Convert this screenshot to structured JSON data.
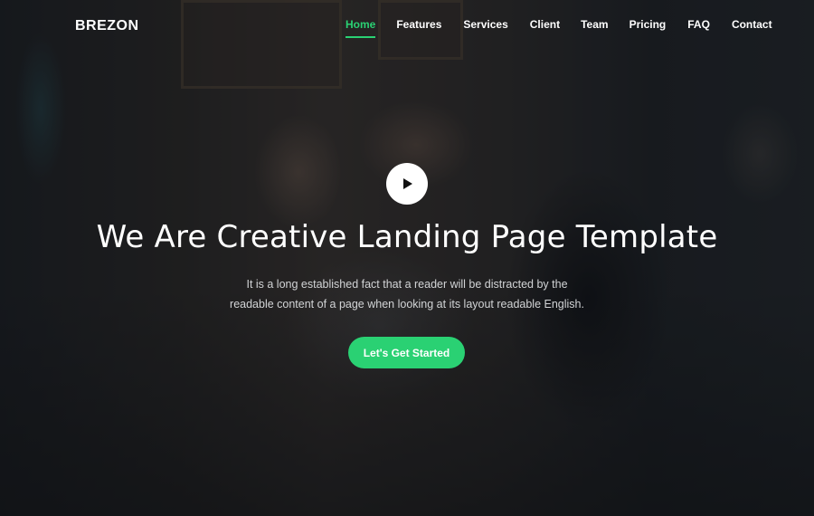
{
  "brand": {
    "logo": "BREZON"
  },
  "nav": {
    "items": [
      {
        "label": "Home",
        "active": true
      },
      {
        "label": "Features",
        "active": false
      },
      {
        "label": "Services",
        "active": false
      },
      {
        "label": "Client",
        "active": false
      },
      {
        "label": "Team",
        "active": false
      },
      {
        "label": "Pricing",
        "active": false
      },
      {
        "label": "FAQ",
        "active": false
      },
      {
        "label": "Contact",
        "active": false
      }
    ]
  },
  "hero": {
    "play_icon": "play-icon",
    "headline": "We Are Creative Landing Page Template",
    "subtext_line1": "It is a long established fact that a reader will be distracted by the",
    "subtext_line2": "readable content of a page when looking at its layout readable English.",
    "cta_label": "Let's Get Started"
  },
  "colors": {
    "accent": "#2ad173",
    "text": "#ffffff",
    "overlay": "#0f1216"
  }
}
